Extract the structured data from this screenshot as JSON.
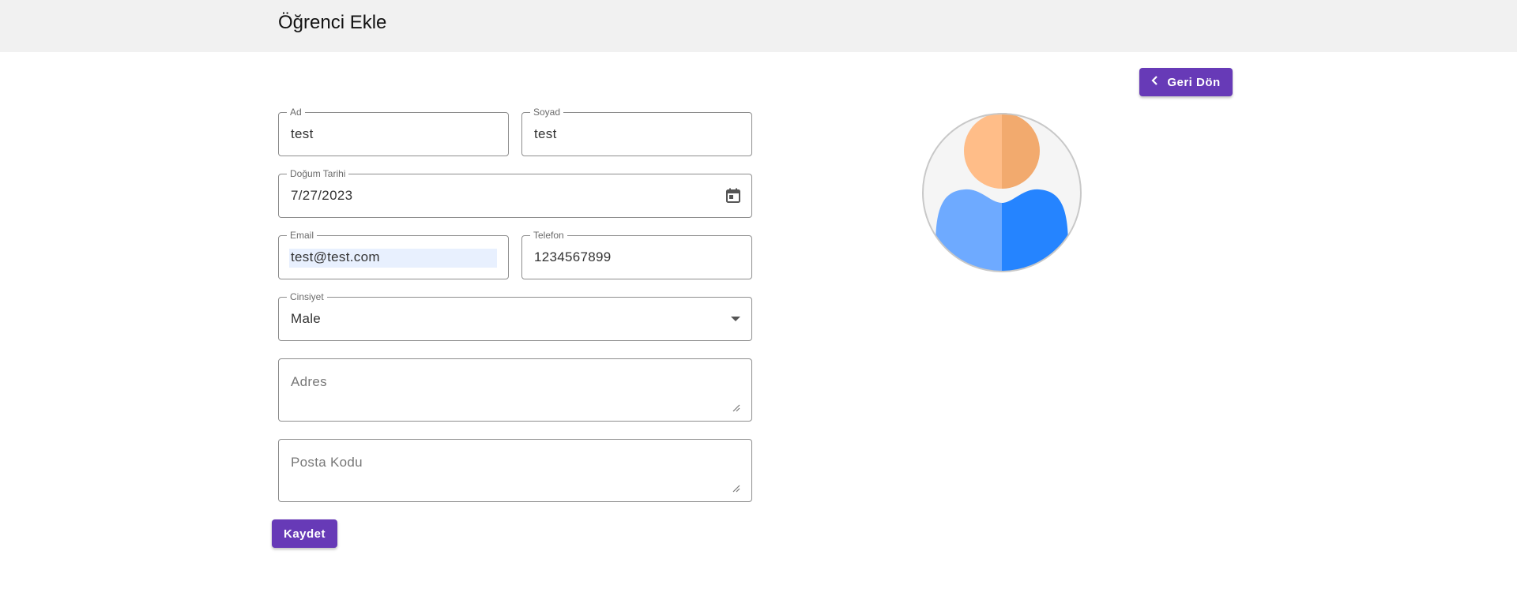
{
  "header": {
    "title": "Öğrenci Ekle"
  },
  "toolbar": {
    "back_label": "Geri Dön",
    "back_icon": "chevron-left-icon"
  },
  "form": {
    "first_name": {
      "label": "Ad",
      "value": "test"
    },
    "last_name": {
      "label": "Soyad",
      "value": "test"
    },
    "birth_date": {
      "label": "Doğum Tarihi",
      "value": "7/27/2023",
      "icon": "calendar-icon"
    },
    "email": {
      "label": "Email",
      "value": "test@test.com"
    },
    "phone": {
      "label": "Telefon",
      "value": "1234567899"
    },
    "gender": {
      "label": "Cinsiyet",
      "value": "Male",
      "icon": "chevron-down-icon"
    },
    "address": {
      "placeholder": "Adres"
    },
    "postal_code": {
      "placeholder": "Posta Kodu"
    },
    "save_label": "Kaydet"
  },
  "avatar": {
    "icon": "user-avatar-icon",
    "colors": {
      "head_light": "#ffbd88",
      "head_dark": "#f2aa6e",
      "body_light": "#6eaaff",
      "body_dark": "#2584ff",
      "bg": "#f5f5f5",
      "ring": "#c8c8c8"
    }
  },
  "theme": {
    "accent": "#673ab7",
    "header_bg": "#f1f1f1"
  }
}
